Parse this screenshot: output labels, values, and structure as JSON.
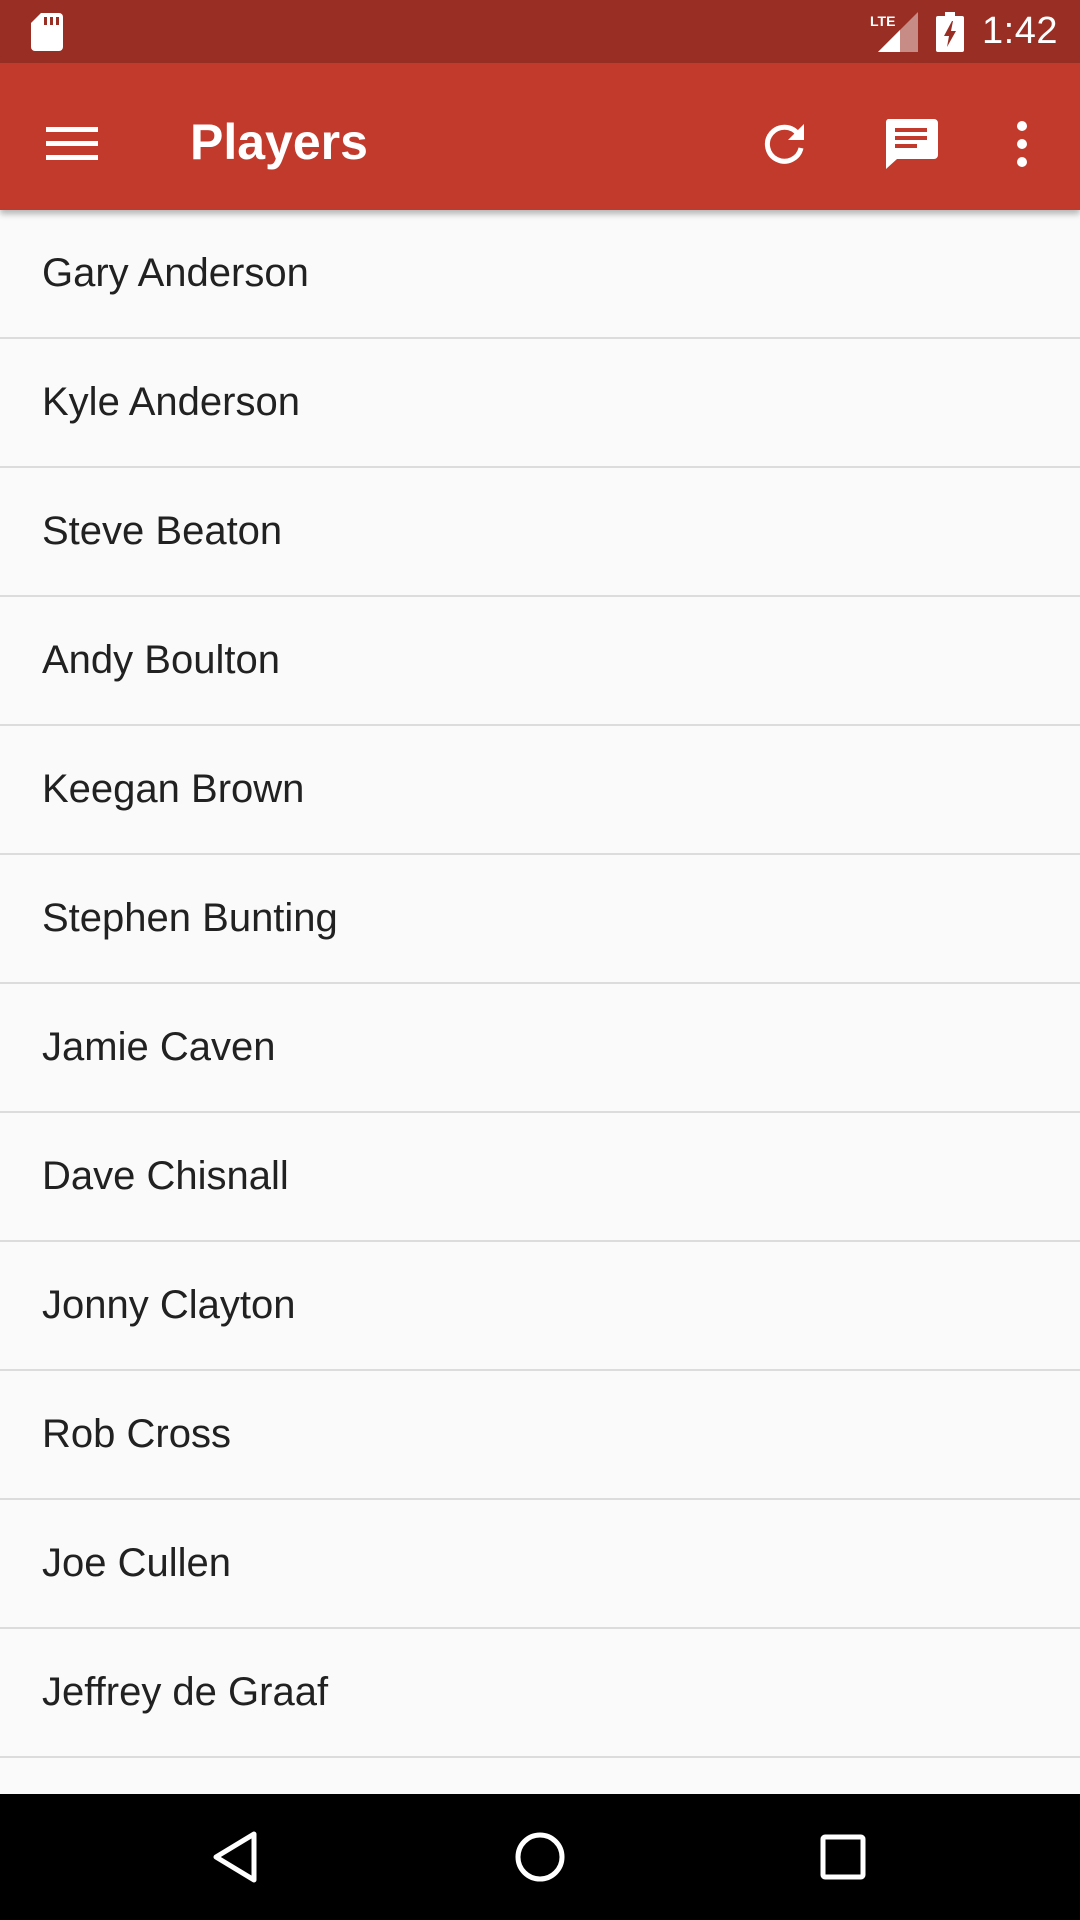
{
  "status_bar": {
    "time": "1:42",
    "network_label": "LTE",
    "icons": [
      "sd-card-icon",
      "lte-signal-icon",
      "battery-charging-icon"
    ]
  },
  "app_bar": {
    "title": "Players",
    "icons": [
      "menu-icon",
      "refresh-icon",
      "chat-icon",
      "more-vert-icon"
    ],
    "color": "#c23a2c",
    "status_color": "#992f24"
  },
  "players": [
    "Gary Anderson",
    "Kyle Anderson",
    "Steve Beaton",
    "Andy Boulton",
    "Keegan Brown",
    "Stephen Bunting",
    "Jamie Caven",
    "Dave Chisnall",
    "Jonny Clayton",
    "Rob Cross",
    "Joe Cullen",
    "Jeffrey de Graaf"
  ],
  "nav_bar": {
    "icons": [
      "back-icon",
      "home-icon",
      "recents-icon"
    ]
  }
}
